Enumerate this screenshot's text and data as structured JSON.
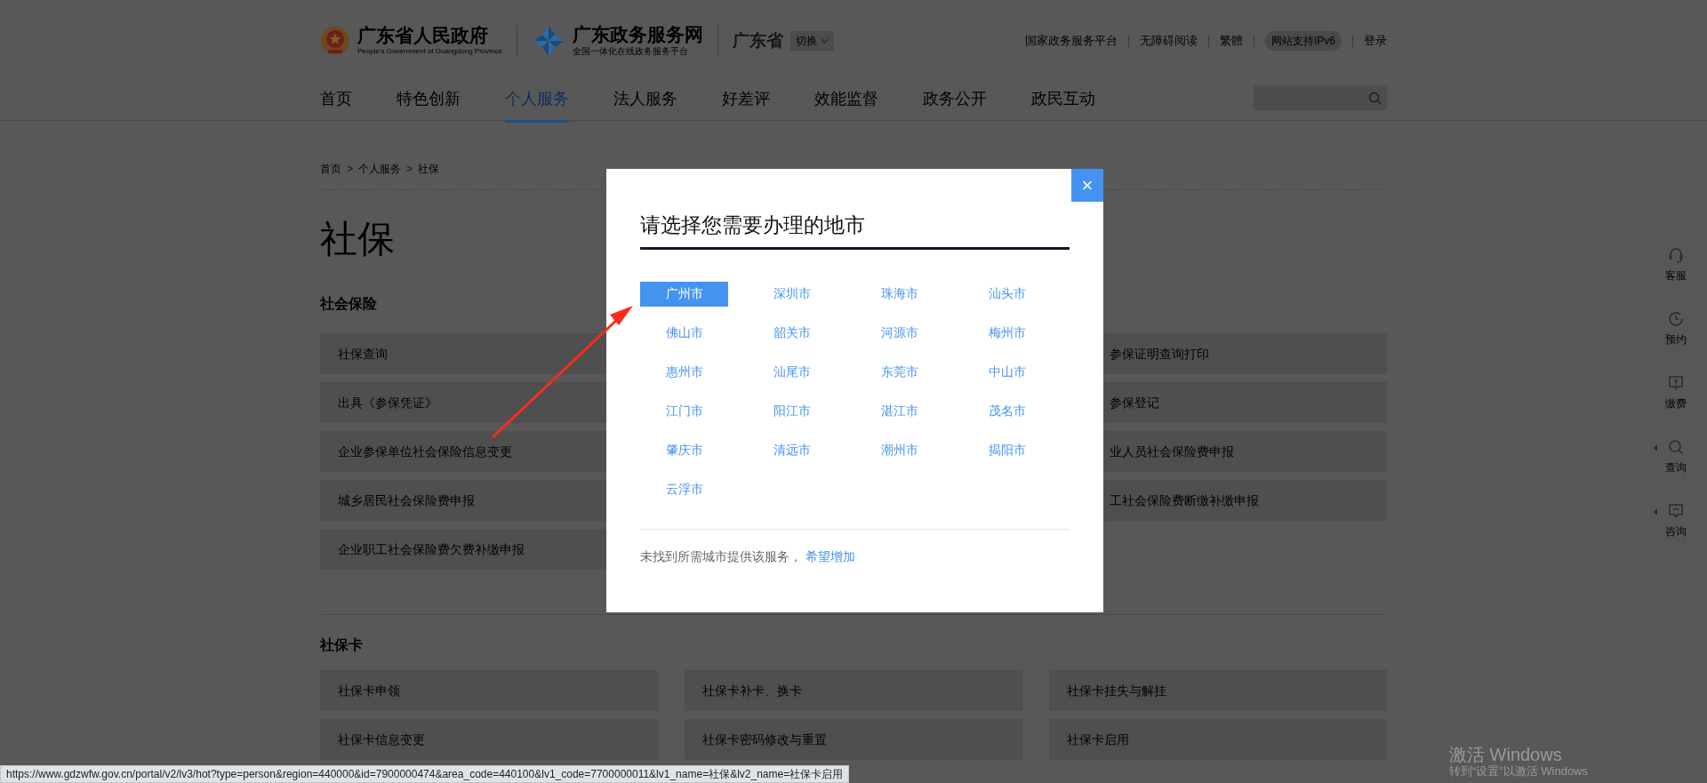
{
  "header": {
    "gov_name": "广东省人民政府",
    "gov_name_en": "People's Government of Guangdong Province",
    "portal_name": "广东政务服务网",
    "portal_subtitle": "全国一体化在线政务服务平台",
    "region": "广东省",
    "switch_label": "切换",
    "top_links": [
      {
        "label": "国家政务服务平台",
        "kind": "link"
      },
      {
        "label": "无障碍阅读",
        "kind": "link"
      },
      {
        "label": "繁體",
        "kind": "link"
      },
      {
        "label": "网站支持IPv6",
        "kind": "pill"
      },
      {
        "label": "登录",
        "kind": "link"
      }
    ]
  },
  "nav": [
    {
      "label": "首页",
      "selected": false
    },
    {
      "label": "特色创新",
      "selected": false
    },
    {
      "label": "个人服务",
      "selected": true
    },
    {
      "label": "法人服务",
      "selected": false
    },
    {
      "label": "好差评",
      "selected": false
    },
    {
      "label": "效能监督",
      "selected": false
    },
    {
      "label": "政务公开",
      "selected": false
    },
    {
      "label": "政民互动",
      "selected": false
    }
  ],
  "breadcrumb": [
    {
      "label": "首页",
      "separator": ">"
    },
    {
      "label": "个人服务",
      "separator": ">"
    },
    {
      "label": "社保"
    }
  ],
  "page_title": "社保",
  "sections": [
    {
      "title": "社会保险",
      "rows": [
        {
          "column_1": "社保查询",
          "column_3": "参保证明查询打印"
        },
        {
          "column_1": "出具《参保凭证》",
          "column_3": "参保登记"
        },
        {
          "column_1": "企业参保单位社会保险信息变更",
          "column_3": "业人员社会保险费申报"
        },
        {
          "column_1": "城乡居民社会保险费申报",
          "column_3": "工社会保险费断缴补缴申报"
        },
        {
          "column_1": "企业职工社会保险费欠费补缴申报"
        }
      ]
    },
    {
      "title": "社保卡",
      "rows": [
        {
          "column_1": "社保卡申领",
          "column_2": "社保卡补卡、换卡",
          "column_3": "社保卡挂失与解挂"
        },
        {
          "column_1": "社保卡信息变更",
          "column_2": "社保卡密码修改与重置",
          "column_3": "社保卡启用"
        }
      ]
    }
  ],
  "modal": {
    "title": "请选择您需要办理的地市",
    "close": "×",
    "cities": [
      {
        "label": "广州市",
        "selected": true
      },
      {
        "label": "深圳市",
        "selected": false
      },
      {
        "label": "珠海市",
        "selected": false
      },
      {
        "label": "汕头市",
        "selected": false
      },
      {
        "label": "佛山市",
        "selected": false
      },
      {
        "label": "韶关市",
        "selected": false
      },
      {
        "label": "河源市",
        "selected": false
      },
      {
        "label": "梅州市",
        "selected": false
      },
      {
        "label": "惠州市",
        "selected": false
      },
      {
        "label": "汕尾市",
        "selected": false
      },
      {
        "label": "东莞市",
        "selected": false
      },
      {
        "label": "中山市",
        "selected": false
      },
      {
        "label": "江门市",
        "selected": false
      },
      {
        "label": "阳江市",
        "selected": false
      },
      {
        "label": "湛江市",
        "selected": false
      },
      {
        "label": "茂名市",
        "selected": false
      },
      {
        "label": "肇庆市",
        "selected": false
      },
      {
        "label": "清远市",
        "selected": false
      },
      {
        "label": "潮州市",
        "selected": false
      },
      {
        "label": "揭阳市",
        "selected": false
      },
      {
        "label": "云浮市",
        "selected": false
      }
    ],
    "footer_text": "未找到所需城市提供该服务，",
    "footer_link": "希望增加"
  },
  "side_toolbar": [
    {
      "label": "客服",
      "kind": "headset",
      "expandable": false
    },
    {
      "label": "预约",
      "kind": "clock",
      "expandable": false
    },
    {
      "label": "缴费",
      "kind": "payment",
      "expandable": false
    },
    {
      "label": "查询",
      "kind": "search",
      "expandable": true
    },
    {
      "label": "咨询",
      "kind": "chat",
      "expandable": true
    }
  ],
  "status_url": "https://www.gdzwfw.gov.cn/portal/v2/lv3/hot?type=person&region=440000&id=7900000474&area_code=440100&lv1_code=7700000011&lv1_name=社保&lv2_name=社保卡启用",
  "os_notice": [
    "激活 Windows",
    "转到“设置”以激活 Windows"
  ]
}
